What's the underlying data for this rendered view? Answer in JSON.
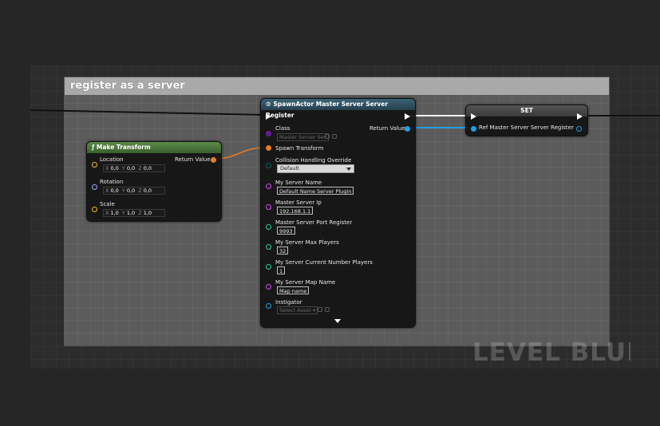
{
  "comment": {
    "title": "register as a server"
  },
  "watermark": "LEVEL BLUEPRINT",
  "make_transform": {
    "title": "Make Transform",
    "return_label": "Return Value",
    "location": {
      "label": "Location",
      "x": "0,0",
      "y": "0,0",
      "z": "0,0"
    },
    "rotation": {
      "label": "Rotation",
      "x": "0,0",
      "y": "0,0",
      "z": "0,0"
    },
    "scale": {
      "label": "Scale",
      "x": "1,0",
      "y": "1,0",
      "z": "1,0"
    },
    "axes": {
      "x": "X",
      "y": "Y",
      "z": "Z"
    }
  },
  "spawn_actor": {
    "title": "SpawnActor Master Server Server Register",
    "class_label": "Class",
    "class_value": "Master Server Se▾",
    "return_label": "Return Value",
    "spawn_transform_label": "Spawn Transform",
    "collision_label": "Collision Handling Override",
    "collision_value": "Default",
    "server_name_label": "My Server Name",
    "server_name_value": "Default Name Server Plugin",
    "ip_label": "Master Server Ip",
    "ip_value": "192.168.1.1",
    "port_label": "Master Server Port Register",
    "port_value": "9993",
    "max_players_label": "My Server Max Players",
    "max_players_value": "32",
    "current_players_label": "My Server Current Number Players",
    "current_players_value": "1",
    "map_name_label": "My Server Map Name",
    "map_name_value": "Map name",
    "instigator_label": "Instigator",
    "instigator_value": "Select Asset ▾"
  },
  "set_node": {
    "title": "SET",
    "var_label": "Ref Master Server Server Register"
  },
  "colors": {
    "exec": "#ffffff",
    "struct": "#e67e22",
    "object": "#1e9fe5",
    "class": "#6a1b9a",
    "string": "#e040fb",
    "int": "#1fd39f",
    "byte": "#00695c",
    "vector": "#f0c419",
    "rotator": "#9aa8ff",
    "make_transform_header": "#4d7a3d",
    "spawn_header": "#2f4f63",
    "set_header": "#4a4a4a"
  }
}
